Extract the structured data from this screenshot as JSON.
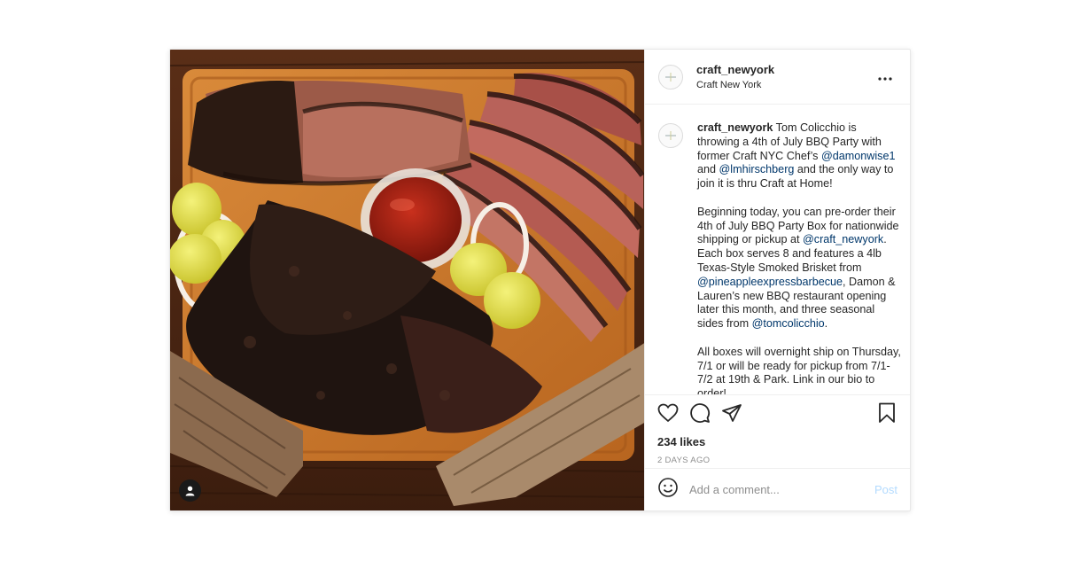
{
  "post": {
    "username": "craft_newyork",
    "location": "Craft New York",
    "caption": {
      "username": "craft_newyork",
      "segments": [
        {
          "text": " Tom Colicchio is throwing a 4th of July BBQ Party with former Craft NYC Chef’s ",
          "mention": false
        },
        {
          "text": "@damonwise1",
          "mention": true
        },
        {
          "text": " and ",
          "mention": false
        },
        {
          "text": "@lmhirschberg",
          "mention": true
        },
        {
          "text": " and the only way to join it is thru Craft at Home!\n\nBeginning today, you can pre-order their 4th of July BBQ Party Box for nationwide shipping or pickup at ",
          "mention": false
        },
        {
          "text": "@craft_newyork",
          "mention": true
        },
        {
          "text": ". Each box serves 8 and features a 4lb Texas-Style Smoked Brisket from ",
          "mention": false
        },
        {
          "text": "@pineappleexpressbarbecue",
          "mention": true
        },
        {
          "text": ", Damon & Lauren’s new BBQ restaurant opening later this month, and three seasonal sides from ",
          "mention": false
        },
        {
          "text": "@tomcolicchio",
          "mention": true
        },
        {
          "text": ".\n\nAll boxes will overnight ship on Thursday, 7/1 or will be ready for pickup from 7/1-7/2 at 19th & Park. Link in our bio to order!",
          "mention": false
        }
      ]
    },
    "likes": "234 likes",
    "timestamp": "2 DAYS AGO",
    "comment": {
      "placeholder": "Add a comment...",
      "value": "",
      "post_label": "Post"
    }
  },
  "icons": {
    "more": "more-options-icon",
    "like": "heart-icon",
    "comment": "comment-bubble-icon",
    "share": "paper-plane-icon",
    "save": "bookmark-icon",
    "emoji": "smiley-icon",
    "tags": "user-tag-icon"
  },
  "colors": {
    "mention": "#00376b",
    "post_button_disabled": "#b3dbff",
    "secondary_text": "#8e8e8e",
    "divider": "#efefef"
  }
}
